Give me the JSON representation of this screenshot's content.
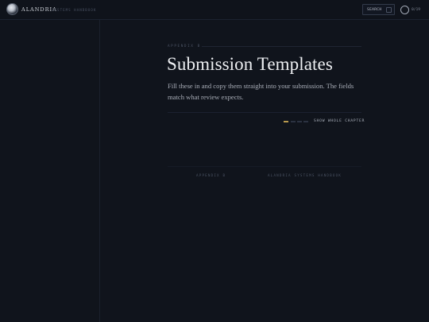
{
  "header": {
    "brand": "ALANDRIA",
    "brand_subtitle": "SYSTEMS HANDBOOK",
    "search_label": "SEARCH",
    "search_shortcut_key": "/",
    "progress_text": "0/19"
  },
  "chapter": {
    "kicker": "APPENDIX B",
    "title": "Submission Templates",
    "lede": "Fill these in and copy them straight into your submission. The fields match what review expects.",
    "show_chapter_label": "SHOW WHOLE CHAPTER",
    "pager": {
      "total": 4,
      "active": 1
    }
  },
  "footer": {
    "left": "APPENDIX B",
    "right": "ALANDRIA SYSTEMS HANDBOOK"
  },
  "colors": {
    "background": "#10141c",
    "accent": "#b99a4e",
    "text": "#eef0f3",
    "muted": "#4d5566"
  }
}
